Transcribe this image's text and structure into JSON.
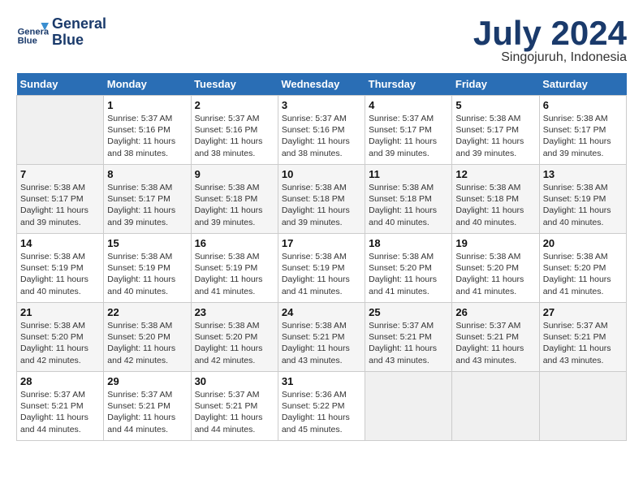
{
  "logo": {
    "line1": "General",
    "line2": "Blue"
  },
  "title": "July 2024",
  "subtitle": "Singojuruh, Indonesia",
  "days_header": [
    "Sunday",
    "Monday",
    "Tuesday",
    "Wednesday",
    "Thursday",
    "Friday",
    "Saturday"
  ],
  "weeks": [
    [
      {
        "day": "",
        "info": ""
      },
      {
        "day": "1",
        "info": "Sunrise: 5:37 AM\nSunset: 5:16 PM\nDaylight: 11 hours\nand 38 minutes."
      },
      {
        "day": "2",
        "info": "Sunrise: 5:37 AM\nSunset: 5:16 PM\nDaylight: 11 hours\nand 38 minutes."
      },
      {
        "day": "3",
        "info": "Sunrise: 5:37 AM\nSunset: 5:16 PM\nDaylight: 11 hours\nand 38 minutes."
      },
      {
        "day": "4",
        "info": "Sunrise: 5:37 AM\nSunset: 5:17 PM\nDaylight: 11 hours\nand 39 minutes."
      },
      {
        "day": "5",
        "info": "Sunrise: 5:38 AM\nSunset: 5:17 PM\nDaylight: 11 hours\nand 39 minutes."
      },
      {
        "day": "6",
        "info": "Sunrise: 5:38 AM\nSunset: 5:17 PM\nDaylight: 11 hours\nand 39 minutes."
      }
    ],
    [
      {
        "day": "7",
        "info": "Sunrise: 5:38 AM\nSunset: 5:17 PM\nDaylight: 11 hours\nand 39 minutes."
      },
      {
        "day": "8",
        "info": "Sunrise: 5:38 AM\nSunset: 5:17 PM\nDaylight: 11 hours\nand 39 minutes."
      },
      {
        "day": "9",
        "info": "Sunrise: 5:38 AM\nSunset: 5:18 PM\nDaylight: 11 hours\nand 39 minutes."
      },
      {
        "day": "10",
        "info": "Sunrise: 5:38 AM\nSunset: 5:18 PM\nDaylight: 11 hours\nand 39 minutes."
      },
      {
        "day": "11",
        "info": "Sunrise: 5:38 AM\nSunset: 5:18 PM\nDaylight: 11 hours\nand 40 minutes."
      },
      {
        "day": "12",
        "info": "Sunrise: 5:38 AM\nSunset: 5:18 PM\nDaylight: 11 hours\nand 40 minutes."
      },
      {
        "day": "13",
        "info": "Sunrise: 5:38 AM\nSunset: 5:19 PM\nDaylight: 11 hours\nand 40 minutes."
      }
    ],
    [
      {
        "day": "14",
        "info": "Sunrise: 5:38 AM\nSunset: 5:19 PM\nDaylight: 11 hours\nand 40 minutes."
      },
      {
        "day": "15",
        "info": "Sunrise: 5:38 AM\nSunset: 5:19 PM\nDaylight: 11 hours\nand 40 minutes."
      },
      {
        "day": "16",
        "info": "Sunrise: 5:38 AM\nSunset: 5:19 PM\nDaylight: 11 hours\nand 41 minutes."
      },
      {
        "day": "17",
        "info": "Sunrise: 5:38 AM\nSunset: 5:19 PM\nDaylight: 11 hours\nand 41 minutes."
      },
      {
        "day": "18",
        "info": "Sunrise: 5:38 AM\nSunset: 5:20 PM\nDaylight: 11 hours\nand 41 minutes."
      },
      {
        "day": "19",
        "info": "Sunrise: 5:38 AM\nSunset: 5:20 PM\nDaylight: 11 hours\nand 41 minutes."
      },
      {
        "day": "20",
        "info": "Sunrise: 5:38 AM\nSunset: 5:20 PM\nDaylight: 11 hours\nand 41 minutes."
      }
    ],
    [
      {
        "day": "21",
        "info": "Sunrise: 5:38 AM\nSunset: 5:20 PM\nDaylight: 11 hours\nand 42 minutes."
      },
      {
        "day": "22",
        "info": "Sunrise: 5:38 AM\nSunset: 5:20 PM\nDaylight: 11 hours\nand 42 minutes."
      },
      {
        "day": "23",
        "info": "Sunrise: 5:38 AM\nSunset: 5:20 PM\nDaylight: 11 hours\nand 42 minutes."
      },
      {
        "day": "24",
        "info": "Sunrise: 5:38 AM\nSunset: 5:21 PM\nDaylight: 11 hours\nand 43 minutes."
      },
      {
        "day": "25",
        "info": "Sunrise: 5:37 AM\nSunset: 5:21 PM\nDaylight: 11 hours\nand 43 minutes."
      },
      {
        "day": "26",
        "info": "Sunrise: 5:37 AM\nSunset: 5:21 PM\nDaylight: 11 hours\nand 43 minutes."
      },
      {
        "day": "27",
        "info": "Sunrise: 5:37 AM\nSunset: 5:21 PM\nDaylight: 11 hours\nand 43 minutes."
      }
    ],
    [
      {
        "day": "28",
        "info": "Sunrise: 5:37 AM\nSunset: 5:21 PM\nDaylight: 11 hours\nand 44 minutes."
      },
      {
        "day": "29",
        "info": "Sunrise: 5:37 AM\nSunset: 5:21 PM\nDaylight: 11 hours\nand 44 minutes."
      },
      {
        "day": "30",
        "info": "Sunrise: 5:37 AM\nSunset: 5:21 PM\nDaylight: 11 hours\nand 44 minutes."
      },
      {
        "day": "31",
        "info": "Sunrise: 5:36 AM\nSunset: 5:22 PM\nDaylight: 11 hours\nand 45 minutes."
      },
      {
        "day": "",
        "info": ""
      },
      {
        "day": "",
        "info": ""
      },
      {
        "day": "",
        "info": ""
      }
    ]
  ]
}
